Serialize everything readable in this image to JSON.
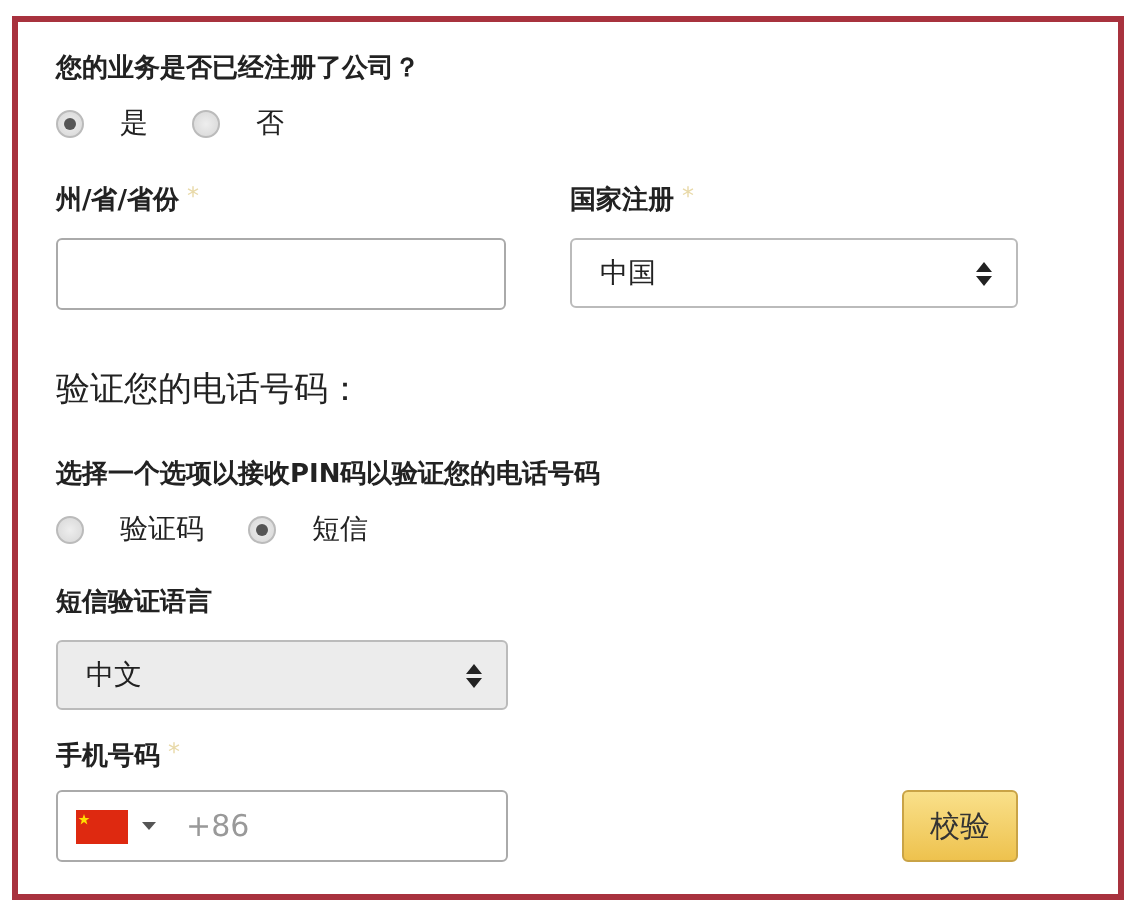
{
  "company_question": {
    "label": "您的业务是否已经注册了公司？",
    "options": [
      {
        "label": "是",
        "selected": true
      },
      {
        "label": "否",
        "selected": false
      }
    ]
  },
  "state_field": {
    "label": "州/省/省份",
    "required_mark": "*"
  },
  "country_field": {
    "label": "国家注册",
    "required_mark": "*",
    "value": "中国"
  },
  "verify_heading": "验证您的电话号码：",
  "pin_question": {
    "label": "选择一个选项以接收PIN码以验证您的电话号码",
    "options": [
      {
        "label": "验证码",
        "selected": false
      },
      {
        "label": "短信",
        "selected": true
      }
    ]
  },
  "sms_language": {
    "label": "短信验证语言",
    "value": "中文"
  },
  "phone_field": {
    "label": "手机号码",
    "required_mark": "*",
    "placeholder": "+86"
  },
  "verify_button": "校验"
}
